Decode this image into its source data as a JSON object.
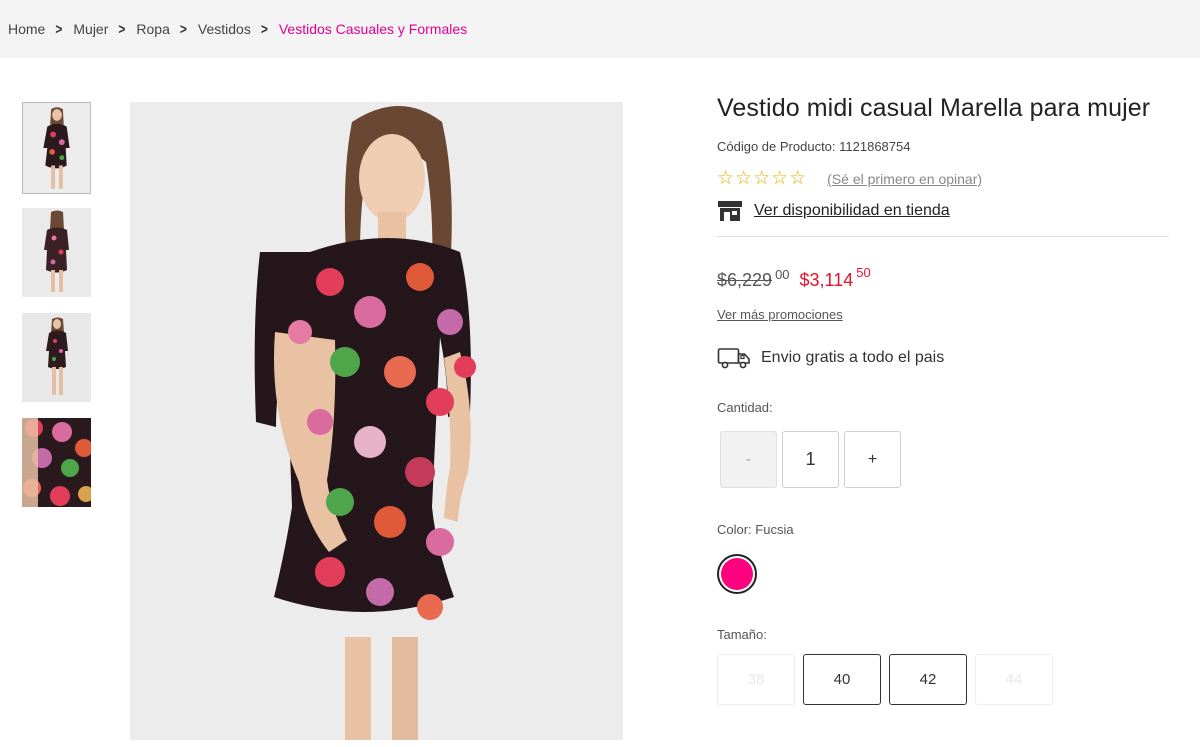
{
  "breadcrumb": {
    "items": [
      "Home",
      "Mujer",
      "Ropa",
      "Vestidos"
    ],
    "current": "Vestidos Casuales y Formales"
  },
  "product": {
    "title": "Vestido midi casual Marella para mujer",
    "code": "Código de Producto: 1121868754",
    "stars": "☆☆☆☆☆",
    "review_link": "(Sé el primero en opinar)",
    "store_link": "Ver disponibilidad en tienda",
    "old_price": "$6,229",
    "old_price_cents": "00",
    "new_price": "$3,114",
    "new_price_cents": "50",
    "promos_link": "Ver más promociones",
    "shipping": "Envio gratis a todo el pais"
  },
  "quantity": {
    "label": "Cantidad:",
    "minus": "-",
    "value": "1",
    "plus": "+"
  },
  "color": {
    "label": "Color: Fucsia",
    "swatch": "#ff007f"
  },
  "size": {
    "label": "Tamaño:",
    "options": [
      "38",
      "40",
      "42",
      "44"
    ],
    "available": [
      false,
      true,
      true,
      false
    ]
  },
  "colors": {
    "accent": "#e10092",
    "sale": "#e8112d",
    "star": "#e7b000"
  }
}
